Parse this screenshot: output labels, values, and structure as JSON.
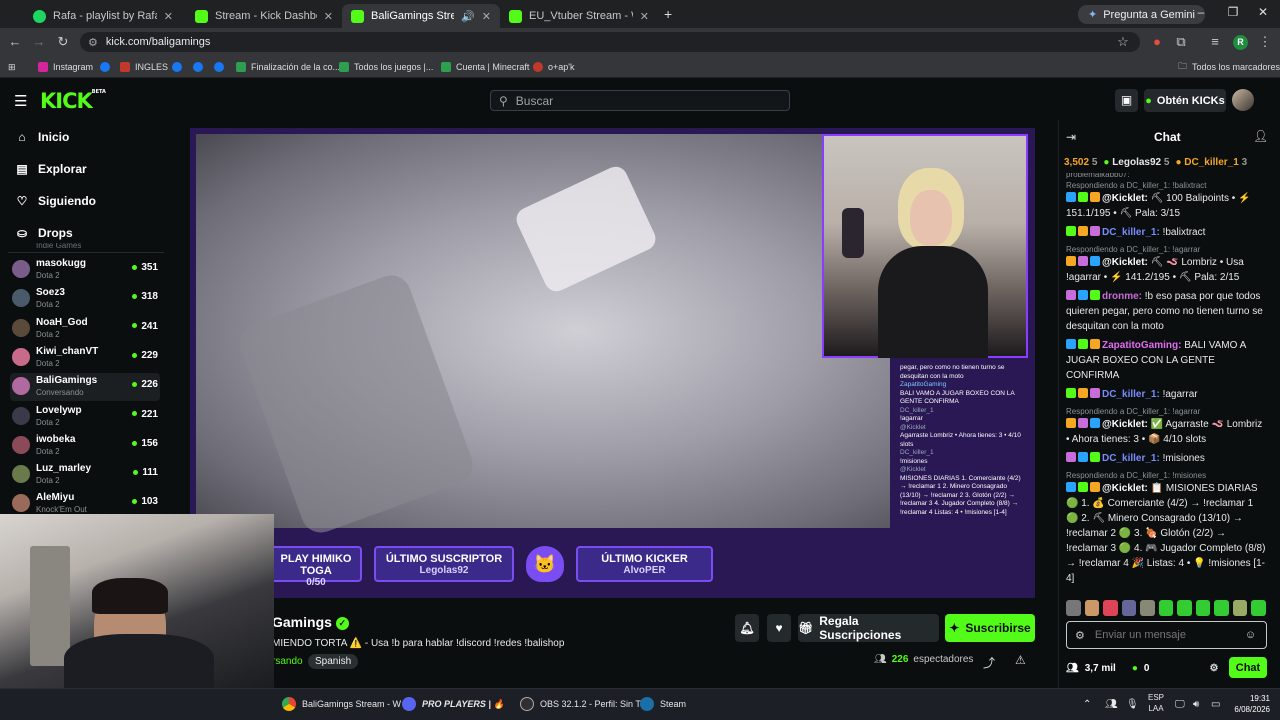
{
  "browser": {
    "tabs": [
      {
        "title": "Rafa - playlist by Rafael.xared |",
        "color": "#1ed760"
      },
      {
        "title": "Stream - Kick Dashboard",
        "color": "#53fc18"
      },
      {
        "title": "BaliGamings Stream - Watc",
        "color": "#53fc18"
      },
      {
        "title": "EU_Vtuber Stream - Watch Live",
        "color": "#53fc18"
      }
    ],
    "new_tab": "+",
    "gemini": "Pregunta a Gemini",
    "url": "kick.com/baligamings",
    "profile_letter": "R",
    "bookmarks": [
      "Instagram",
      "INGLES",
      "Finalización de la co...",
      "Todos los juegos |...",
      "Cuenta | Minecraft",
      "o+ap'k"
    ],
    "all_bookmarks": "Todos los marcadores"
  },
  "kick": {
    "logo": "KICK",
    "logo_beta": "BETA",
    "search_placeholder": "Buscar",
    "get_kicks": "Obtén KICKs",
    "accent": "#53fc18"
  },
  "sidebar": {
    "nav": [
      {
        "label": "Inicio",
        "icon": "home-icon"
      },
      {
        "label": "Explorar",
        "icon": "compass-icon"
      },
      {
        "label": "Siguiendo",
        "icon": "heart-icon"
      },
      {
        "label": "Drops",
        "icon": "drops-icon"
      }
    ],
    "partial_game": "Indie Games",
    "channels": [
      {
        "name": "masokugg",
        "game": "Dota 2",
        "viewers": "351",
        "color": "#7a5c8a"
      },
      {
        "name": "Soez3",
        "game": "Dota 2",
        "viewers": "318",
        "color": "#4a5a6a"
      },
      {
        "name": "NoaH_God",
        "game": "Dota 2",
        "viewers": "241",
        "color": "#5a4a3a"
      },
      {
        "name": "Kiwi_chanVT",
        "game": "Dota 2",
        "viewers": "229",
        "color": "#c86a8a"
      },
      {
        "name": "BaliGamings",
        "game": "Conversando",
        "viewers": "226",
        "color": "#b06aa0"
      },
      {
        "name": "Lovelywp",
        "game": "Dota 2",
        "viewers": "221",
        "color": "#3a3a4a"
      },
      {
        "name": "iwobeka",
        "game": "Dota 2",
        "viewers": "156",
        "color": "#8a4a5a"
      },
      {
        "name": "Luz_marley",
        "game": "Dota 2",
        "viewers": "111",
        "color": "#6a7a4a"
      },
      {
        "name": "AleMiyu",
        "game": "Knock'Em Out",
        "viewers": "103",
        "color": "#9a6a5a"
      }
    ]
  },
  "stream": {
    "overlay_chat": [
      "pegar, pero como no tienen turno se desquitan con la moto",
      "ZapatitoGaming",
      "BALI VAMO A JUGAR BOXEO CON LA GENTE CONFIRMA",
      "DC_killer_1",
      "!agarrar",
      "@Kicklet",
      "Agarraste Lombriz • Ahora tienes: 3 • 4/10 slots",
      "DC_killer_1",
      "!misiones",
      "@Kicklet",
      "MISIONES DIARIAS 1. Comerciante (4/2) → !reclamar 1 2. Minero Consagrado (13/10) → !reclamar 2 3. Glotón (2/2) → !reclamar 3 4. Jugador Completo (8/8) → !reclamar 4 Listas: 4 • !misiones [1-4]"
    ],
    "badge_left_title": "PLAY HIMIKO TOGA",
    "badge_left_sub": "0/50",
    "last_sub_title": "ÚLTIMO SUSCRIPTOR",
    "last_sub_name": "Legolas92",
    "last_kicker_title": "ÚLTIMO KICKER",
    "last_kicker_name": "AlvoPER",
    "channel_name": "Gamings",
    "title": "MIENDO TORTA ⚠️ - Usa !b para hablar !discord !redes !balishop",
    "category": "rsando",
    "language": "Spanish",
    "gift_subs": "Regala Suscripciones",
    "subscribe": "Suscribirse",
    "viewers": "226",
    "viewers_label": "espectadores"
  },
  "chat": {
    "title": "Chat",
    "gifters": [
      {
        "name": "3,502",
        "count": "5"
      },
      {
        "name": "Legolas92",
        "count": "5"
      },
      {
        "name": "DC_killer_1",
        "count": "3"
      }
    ],
    "partial_top": "problemaikabb07:",
    "messages": [
      {
        "reply": "Respondiendo a DC_killer_1: !balixtract",
        "user": "@Kicklet:",
        "color": "#ffffff",
        "text": "⛏ 100 Balipoints • ⚡ 151.1/195 • ⛏ Pala: 3/15"
      },
      {
        "reply": "",
        "user": "DC_killer_1:",
        "color": "#7b8bff",
        "text": "!balixtract"
      },
      {
        "reply": "Respondiendo a DC_killer_1: !agarrar",
        "user": "@Kicklet:",
        "color": "#ffffff",
        "text": "⛏ 🪱 Lombriz • Usa !agarrar • ⚡ 141.2/195 • ⛏ Pala: 2/15"
      },
      {
        "reply": "",
        "user": "dronme:",
        "color": "#c76cd8",
        "text": "!b eso pasa por que todos quieren pegar, pero como no tienen turno se desquitan con la moto"
      },
      {
        "reply": "",
        "user": "ZapatitoGaming:",
        "color": "#e06cf0",
        "text": "BALI VAMO A JUGAR BOXEO CON LA GENTE CONFIRMA"
      },
      {
        "reply": "",
        "user": "DC_killer_1:",
        "color": "#7b8bff",
        "text": "!agarrar"
      },
      {
        "reply": "Respondiendo a DC_killer_1: !agarrar",
        "user": "@Kicklet:",
        "color": "#ffffff",
        "text": "✅ Agarraste 🪱 Lombriz • Ahora tienes: 3 • 📦 4/10 slots"
      },
      {
        "reply": "",
        "user": "DC_killer_1:",
        "color": "#7b8bff",
        "text": "!misiones"
      },
      {
        "reply": "Respondiendo a DC_killer_1: !misiones",
        "user": "@Kicklet:",
        "color": "#ffffff",
        "text": "📋 MISIONES DIARIAS 🟢 1. 💰 Comerciante (4/2) → !reclamar 1 🟢 2. ⛏ Minero Consagrado (13/10) → !reclamar 2 🟢 3. 🍖 Glotón (2/2) → !reclamar 3 🟢 4. 🎮 Jugador Completo (8/8) → !reclamar 4 🎉 Listas: 4 • 💡 !misiones [1-4]"
      }
    ],
    "input_placeholder": "Enviar un mensaje",
    "followers": "3,7 mil",
    "kicks": "0",
    "send": "Chat"
  },
  "taskbar": {
    "items": [
      "BaliGamings Stream - W",
      "PRO PLAYERS | 🔥",
      "OBS 32.1.2 - Perfil: Sin Tí",
      "Steam"
    ],
    "lang": "ESP",
    "lang2": "LAA",
    "time": "19:31",
    "date": "6/08/2026"
  }
}
